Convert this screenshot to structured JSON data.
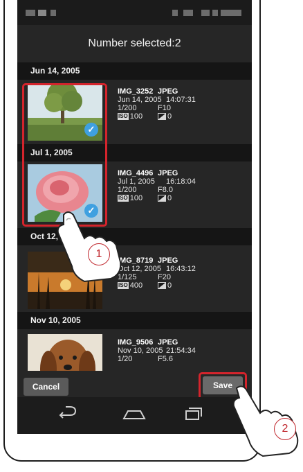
{
  "header": {
    "title": "Number selected:2"
  },
  "photos": [
    {
      "date": "Jun 14, 2005",
      "filename": "IMG_3252",
      "format": "JPEG",
      "datetime_date": "Jun 14, 2005",
      "datetime_time": "14:07:31",
      "shutter": "1/200",
      "aperture": "F10",
      "iso": "100",
      "ev": "0",
      "selected": true
    },
    {
      "date": "Jul 1, 2005",
      "filename": "IMG_4496",
      "format": "JPEG",
      "datetime_date": "Jul 1, 2005",
      "datetime_time": "16:18:04",
      "shutter": "1/200",
      "aperture": "F8.0",
      "iso": "100",
      "ev": "0",
      "selected": true
    },
    {
      "date": "Oct 12, 2005",
      "filename": "IMG_8719",
      "format": "JPEG",
      "datetime_date": "Oct 12, 2005",
      "datetime_time": "16:43:12",
      "shutter": "1/125",
      "aperture": "F20",
      "iso": "400",
      "ev": "0",
      "selected": false
    },
    {
      "date": "Nov 10, 2005",
      "filename": "IMG_9506",
      "format": "JPEG",
      "datetime_date": "Nov 10, 2005",
      "datetime_time": "21:54:34",
      "shutter": "1/20",
      "aperture": "F5.6",
      "iso": "",
      "ev": "",
      "selected": false
    }
  ],
  "labels": {
    "iso_icon": "ISO",
    "check_icon": "✓"
  },
  "actions": {
    "cancel": "Cancel",
    "save": "Save"
  },
  "callouts": {
    "step1": "1",
    "step2": "2"
  },
  "colors": {
    "screen_bg": "#262626",
    "header_bg": "#151515",
    "highlight": "#d4242c",
    "check": "#3fa0e0"
  }
}
